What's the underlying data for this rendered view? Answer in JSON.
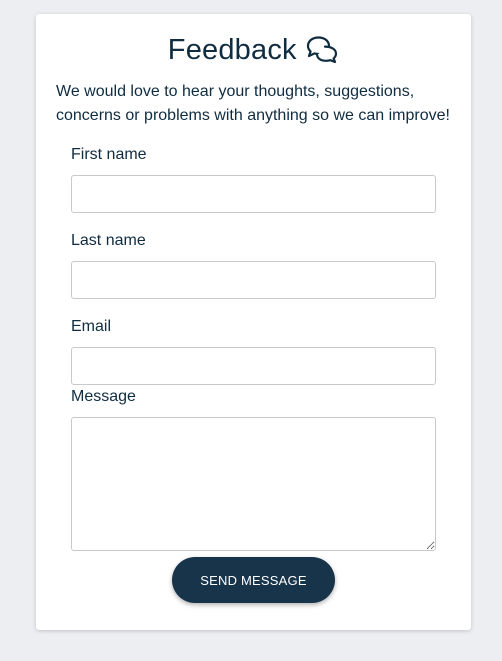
{
  "form": {
    "title": "Feedback",
    "title_icon": "chat-bubbles-icon",
    "intro": "We would love to hear your thoughts, suggestions, concerns or problems with anything so we can improve!",
    "fields": {
      "first_name": {
        "label": "First name",
        "value": "",
        "placeholder": ""
      },
      "last_name": {
        "label": "Last name",
        "value": "",
        "placeholder": ""
      },
      "email": {
        "label": "Email",
        "value": "",
        "placeholder": ""
      },
      "message": {
        "label": "Message",
        "value": "",
        "placeholder": ""
      }
    },
    "submit_label": "SEND MESSAGE"
  },
  "colors": {
    "background": "#eceef1",
    "card": "#ffffff",
    "text": "#0f2c40",
    "button": "#18344b",
    "button_text": "#ffffff",
    "input_border": "#c9c9c9"
  }
}
